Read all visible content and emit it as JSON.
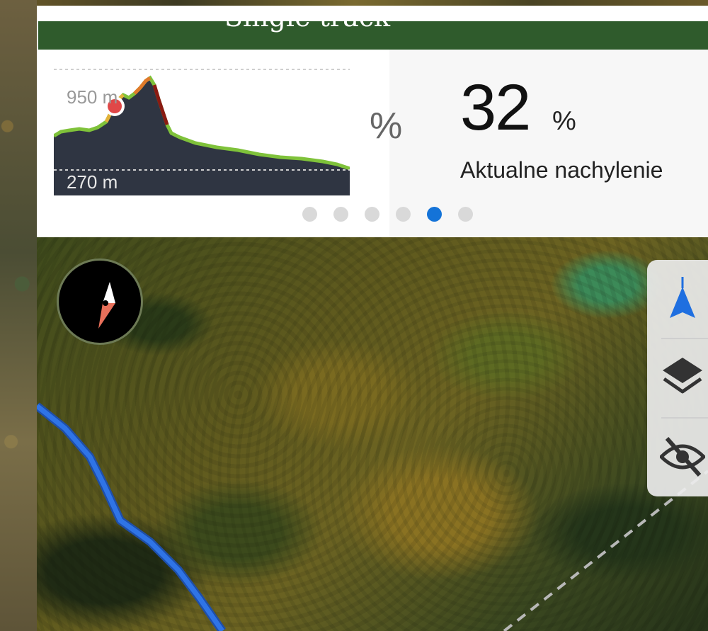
{
  "header": {
    "title": "Single track"
  },
  "elevation": {
    "max_label": "950 m",
    "min_label": "270 m"
  },
  "stat": {
    "icon": "%",
    "value": "32",
    "unit": "%",
    "label": "Aktualne nachylenie"
  },
  "pager": {
    "count": 6,
    "active_index": 4
  },
  "colors": {
    "header_green": "#2f5b2c",
    "route_blue": "#1f5fd6",
    "active_dot": "#1473d8"
  },
  "map_controls": [
    {
      "icon": "navigation-arrow-icon"
    },
    {
      "icon": "layers-icon"
    },
    {
      "icon": "hide-eye-icon"
    }
  ],
  "compass": {
    "icon": "compass-icon"
  }
}
